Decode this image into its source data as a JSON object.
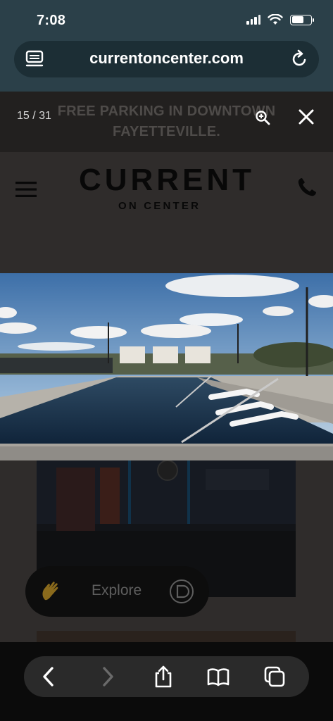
{
  "status_bar": {
    "time": "7:08"
  },
  "browser": {
    "url": "currentoncenter.com"
  },
  "lightbox": {
    "counter": "15 / 31"
  },
  "promo": {
    "text": "FREE PARKING IN DOWNTOWN FAYETTEVILLE."
  },
  "logo": {
    "wordmark": "CURRENT",
    "subtitle": "ON CENTER"
  },
  "gallery": {
    "photo_name": "rooftop-pool-photo",
    "thumb_name": "game-room-photo"
  },
  "explore_widget": {
    "label": "Explore"
  },
  "toolbar": {
    "items": [
      "back",
      "forward",
      "share",
      "bookmarks",
      "tabs"
    ]
  },
  "colors": {
    "chrome_bg": "#2b4049",
    "page_dim": "#2f2c2b",
    "promo_text": "#4e4b49",
    "toolbar_bg": "#0b0b0b"
  }
}
